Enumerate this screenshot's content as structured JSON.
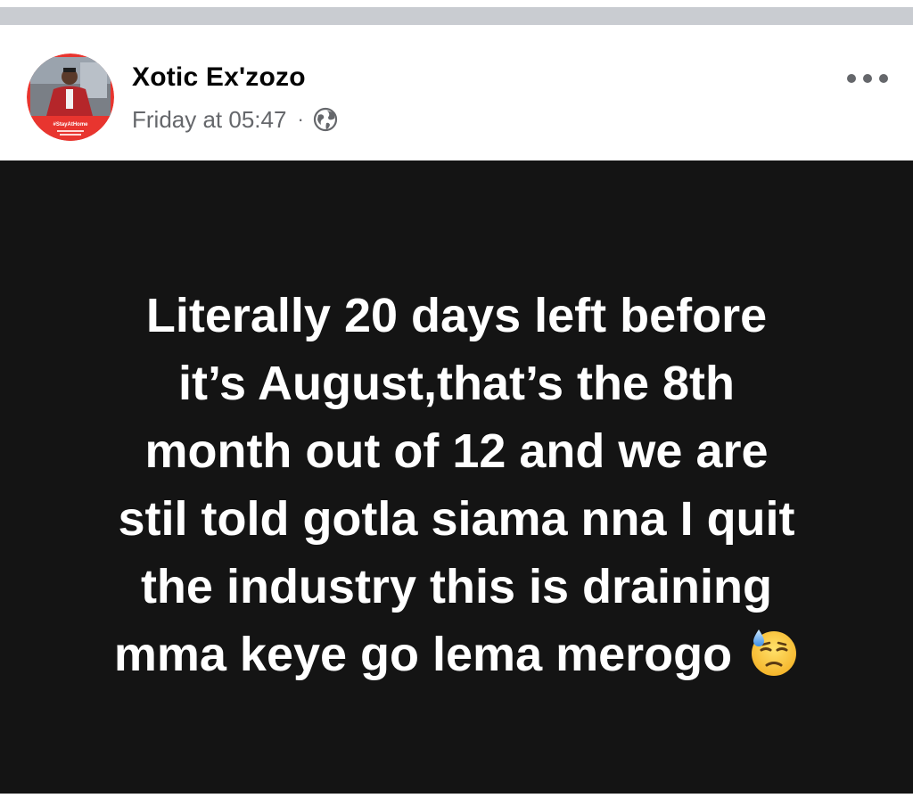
{
  "post": {
    "author_name": "Xotic Ex'zozo",
    "timestamp": "Friday at 05:47",
    "separator": "·",
    "audience_icon": "globe-icon",
    "more_icon": "more-options-icon",
    "avatar_badge_text": "#StayAtHome",
    "body_lines": [
      "Literally 20 days left before",
      "it’s August,that’s the 8th",
      "month out of 12 and we are",
      "stil told gotla siama nna I quit",
      "the industry this is draining",
      "mma keye go lema merogo"
    ],
    "emoji": "downcast-face-with-sweat-emoji"
  },
  "colors": {
    "background": "#ffffff",
    "divider": "#c9ccd1",
    "body_background": "#141414",
    "body_text": "#ffffff",
    "name_text": "#050505",
    "meta_text": "#65676b",
    "avatar_ring": "#e8352f"
  }
}
